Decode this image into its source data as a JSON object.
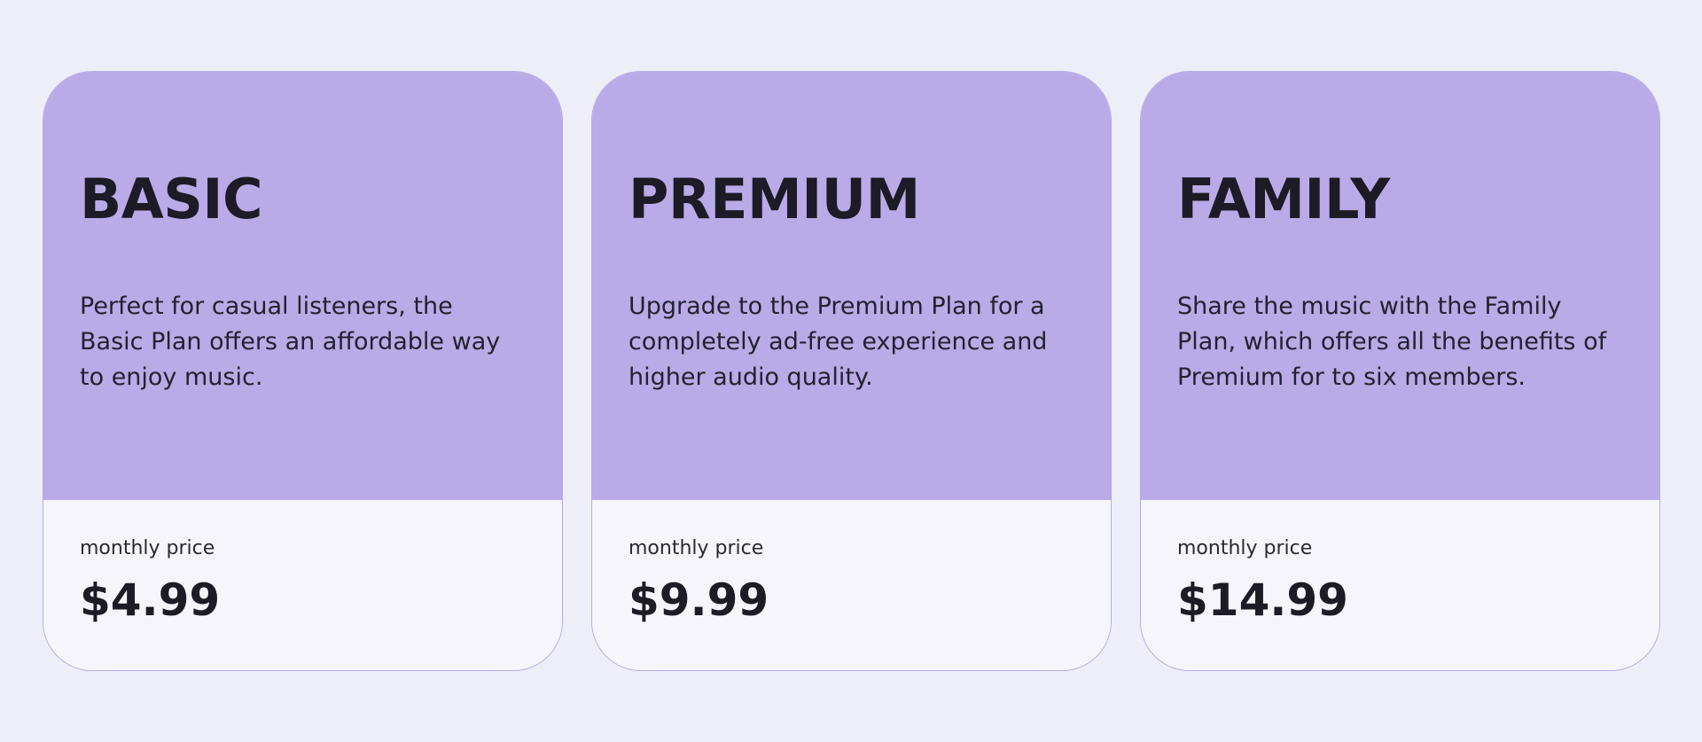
{
  "plans": [
    {
      "name": "BASIC",
      "description": "Perfect for casual listeners, the Basic Plan offers an affordable way to enjoy music.",
      "price_label": "monthly price",
      "price": "$4.99"
    },
    {
      "name": "PREMIUM",
      "description": "Upgrade to the Premium Plan for a completely ad-free experience and higher audio quality.",
      "price_label": "monthly price",
      "price": "$9.99"
    },
    {
      "name": "FAMILY",
      "description": "Share the music with the Family Plan, which offers all the benefits of Premium for to six members.",
      "price_label": "monthly price",
      "price": "$14.99"
    }
  ],
  "colors": {
    "page_background": "#eeeef8",
    "card_header": "#b9abe7",
    "card_footer": "#f5f5fb",
    "text": "#1c1b26"
  }
}
